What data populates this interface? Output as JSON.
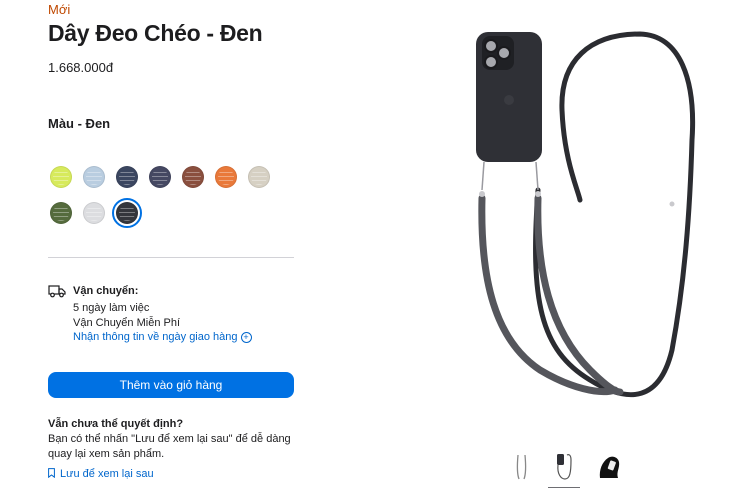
{
  "product": {
    "badge": "Mới",
    "title": "Dây Đeo Chéo - Đen",
    "price": "1.668.000đ",
    "color_label": "Màu - Đen"
  },
  "swatches": [
    {
      "name": "swatch-yellow-green",
      "color": "#d7ea5c"
    },
    {
      "name": "swatch-light-blue",
      "color": "#b9cde0"
    },
    {
      "name": "swatch-navy",
      "color": "#3b4660"
    },
    {
      "name": "swatch-dark-indigo",
      "color": "#454862"
    },
    {
      "name": "swatch-brown",
      "color": "#8a4f3e"
    },
    {
      "name": "swatch-orange",
      "color": "#e9793a"
    },
    {
      "name": "swatch-beige",
      "color": "#d6d0c3"
    },
    {
      "name": "swatch-olive",
      "color": "#556b3d"
    },
    {
      "name": "swatch-light-gray",
      "color": "#dcdde0"
    },
    {
      "name": "swatch-black",
      "color": "#34363c",
      "selected": true
    }
  ],
  "shipping": {
    "title": "Vận chuyển:",
    "line1": "5 ngày làm việc",
    "line2": "Vận Chuyển Miễn Phí",
    "link": "Nhận thông tin về ngày giao hàng"
  },
  "add_to_bag_label": "Thêm vào giỏ hàng",
  "undecided": {
    "title": "Vẫn chưa thể quyết định?",
    "body": "Bạn có thể nhấn \"Lưu để xem lại sau\" để dễ dàng quay lại xem sản phẩm.",
    "save_link": "Lưu để xem lại sau"
  },
  "thumbnails": [
    "thumbnail-strap",
    "thumbnail-phone-strap",
    "thumbnail-lifestyle"
  ]
}
